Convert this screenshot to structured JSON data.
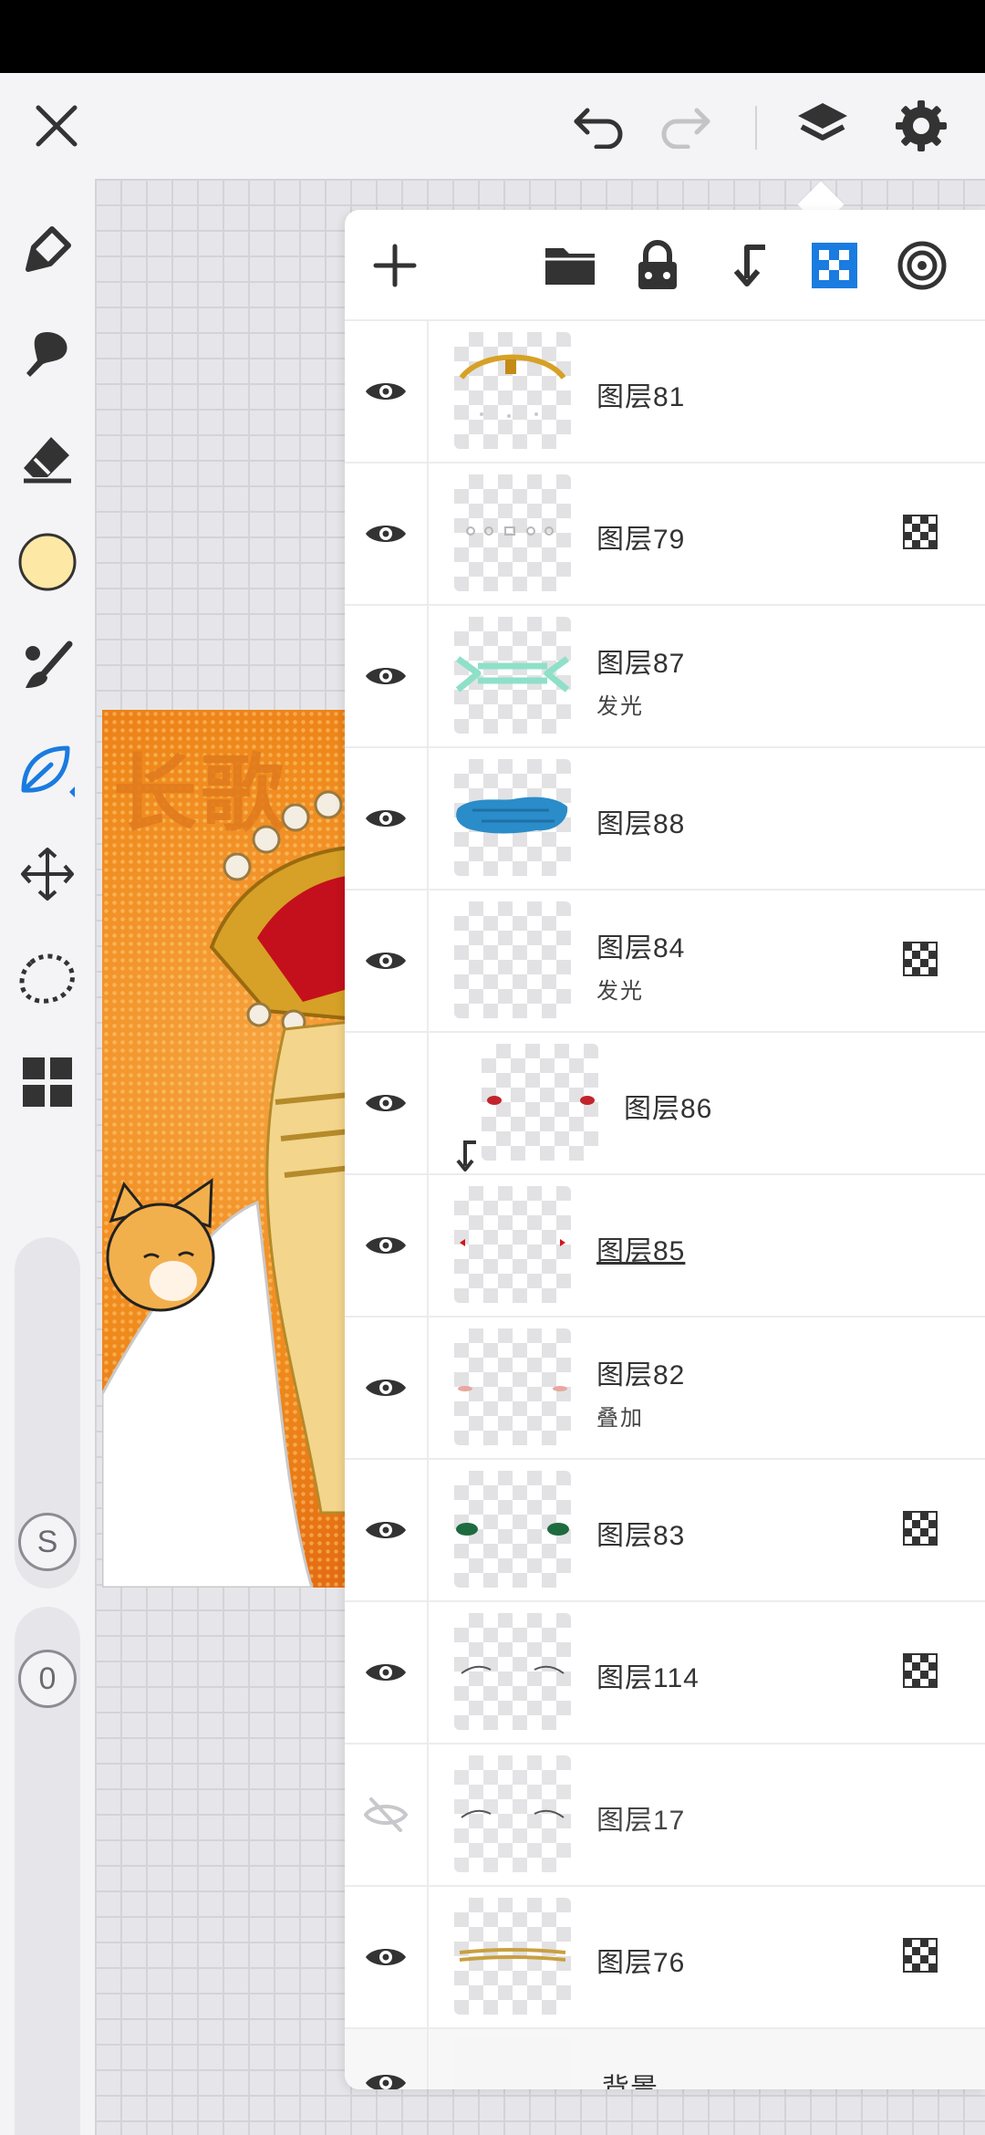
{
  "toolbar": {
    "close_icon": "close-icon",
    "undo_icon": "undo-icon",
    "redo_icon": "redo-icon",
    "layers_icon": "layers-icon",
    "settings_icon": "gear-icon"
  },
  "tools": {
    "items": [
      "pen-icon",
      "smudge-icon",
      "eraser-icon",
      "color-swatch",
      "brush-icon",
      "leaf-icon",
      "move-icon",
      "lasso-icon",
      "grid-icon"
    ],
    "current_color": "#fde8a6",
    "active_color": "#1a7be0"
  },
  "sliders": {
    "size_label": "S",
    "opacity_label": "0"
  },
  "artwork": {
    "title_text": "长歌"
  },
  "layer_panel": {
    "toolbar_icons": [
      "add-icon",
      "folder-icon",
      "lock-icon",
      "clip-icon",
      "alpha-lock-icon",
      "target-icon"
    ],
    "layers": [
      {
        "name": "图层81",
        "mode": "",
        "visible": true,
        "alpha_lock": false,
        "clipped": false,
        "underline": false
      },
      {
        "name": "图层79",
        "mode": "",
        "visible": true,
        "alpha_lock": true,
        "clipped": false,
        "underline": false
      },
      {
        "name": "图层87",
        "mode": "发光",
        "visible": true,
        "alpha_lock": false,
        "clipped": false,
        "underline": false
      },
      {
        "name": "图层88",
        "mode": "",
        "visible": true,
        "alpha_lock": false,
        "clipped": false,
        "underline": false
      },
      {
        "name": "图层84",
        "mode": "发光",
        "visible": true,
        "alpha_lock": true,
        "clipped": false,
        "underline": false
      },
      {
        "name": "图层86",
        "mode": "",
        "visible": true,
        "alpha_lock": false,
        "clipped": true,
        "underline": false
      },
      {
        "name": "图层85",
        "mode": "",
        "visible": true,
        "alpha_lock": false,
        "clipped": false,
        "underline": true
      },
      {
        "name": "图层82",
        "mode": "叠加",
        "visible": true,
        "alpha_lock": false,
        "clipped": false,
        "underline": false
      },
      {
        "name": "图层83",
        "mode": "",
        "visible": true,
        "alpha_lock": true,
        "clipped": false,
        "underline": false
      },
      {
        "name": "图层114",
        "mode": "",
        "visible": true,
        "alpha_lock": true,
        "clipped": false,
        "underline": false
      },
      {
        "name": "图层17",
        "mode": "",
        "visible": false,
        "alpha_lock": false,
        "clipped": false,
        "underline": false
      },
      {
        "name": "图层76",
        "mode": "",
        "visible": true,
        "alpha_lock": true,
        "clipped": false,
        "underline": false
      }
    ],
    "background_layer": {
      "name": "背景",
      "visible": true
    }
  }
}
